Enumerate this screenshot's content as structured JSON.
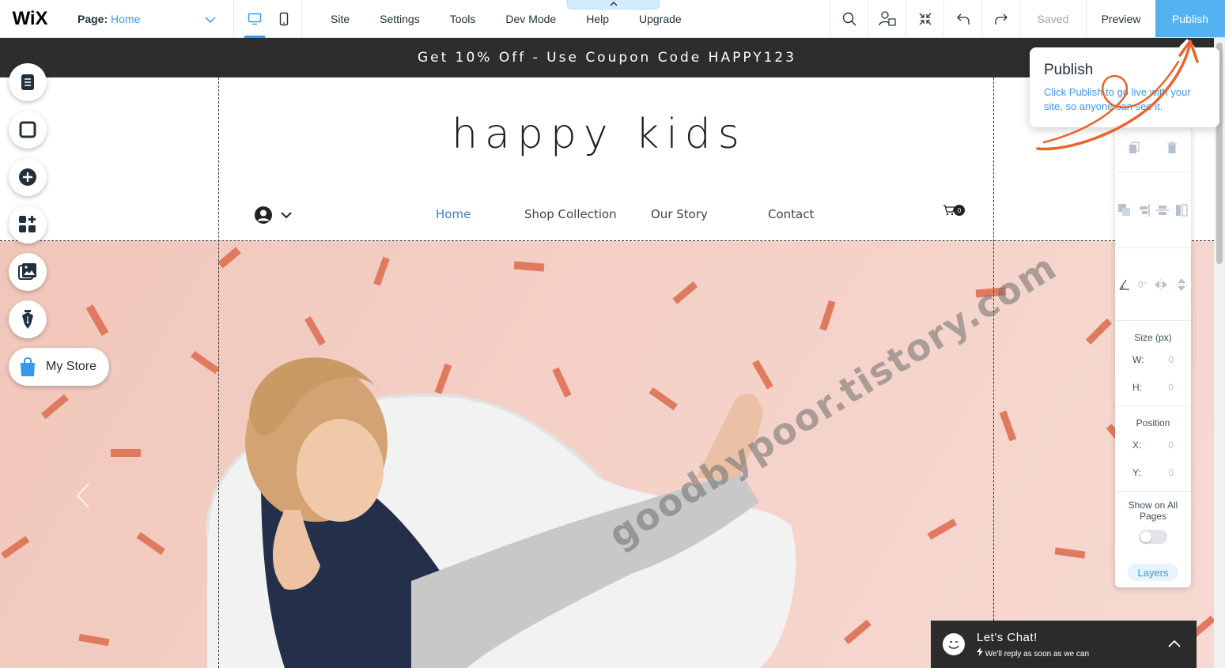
{
  "topbar": {
    "logo": "WiX",
    "page_label": "Page:",
    "page_value": "Home",
    "menu": [
      "Site",
      "Settings",
      "Tools",
      "Dev Mode",
      "Help",
      "Upgrade"
    ],
    "saved": "Saved",
    "preview": "Preview",
    "publish": "Publish"
  },
  "site": {
    "announcement": "Get 10% Off - Use Coupon Code HAPPY123",
    "brand": "happy kids",
    "nav": [
      "Home",
      "Shop Collection",
      "Our Story",
      "Contact"
    ],
    "cart_count": "0"
  },
  "left_tools": {
    "my_store": "My Store"
  },
  "tooltip": {
    "title": "Publish",
    "text": "Click Publish to go live with your site, so anyone can see it."
  },
  "panel": {
    "rotation": "0°",
    "size_title": "Size (px)",
    "w_label": "W:",
    "w_value": "0",
    "h_label": "H:",
    "h_value": "0",
    "position_title": "Position",
    "x_label": "X:",
    "x_value": "0",
    "y_label": "Y:",
    "y_value": "0",
    "show_all": "Show on All Pages",
    "layers": "Layers"
  },
  "chat": {
    "title": "Let's Chat!",
    "subtitle": "We'll reply as soon as we can"
  },
  "watermark": "goodbypoor.tistory.com",
  "colors": {
    "accent": "#3899ec",
    "publish_bg": "#52b3f0",
    "hero_bg": "#f3ccc1",
    "confetti": "#e07a5f",
    "annotation": "#e8642c"
  }
}
